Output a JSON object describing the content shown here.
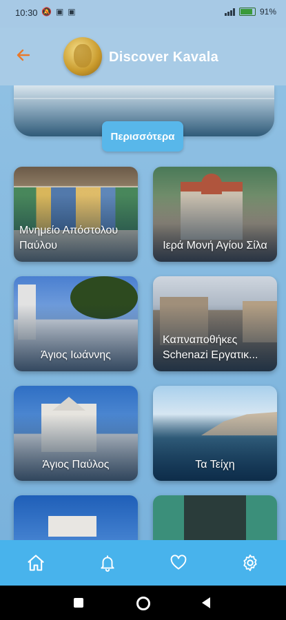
{
  "status_bar": {
    "time": "10:30",
    "icons": [
      "mute-icon",
      "sim-icon",
      "sim-icon"
    ],
    "battery": "91%"
  },
  "header": {
    "back_icon": "back-arrow-icon",
    "title": "Discover Kavala",
    "accent_color": "#e8792b"
  },
  "main": {
    "more_button": "Περισσότερα",
    "places": [
      {
        "name": "Μνημείο Απόστολου Παύλου"
      },
      {
        "name": "Ιερά Μονή Αγίου Σίλα"
      },
      {
        "name": "Άγιος Ιωάννης"
      },
      {
        "name": "Καπναποθήκες Schenazi Εργατικ..."
      },
      {
        "name": "Άγιος Παύλος"
      },
      {
        "name": "Τα Τείχη"
      },
      {
        "name": ""
      },
      {
        "name": ""
      }
    ]
  },
  "bottom_nav": {
    "items": [
      "home-icon",
      "bell-icon",
      "heart-icon",
      "gear-icon"
    ],
    "color": "#48b3ec"
  }
}
